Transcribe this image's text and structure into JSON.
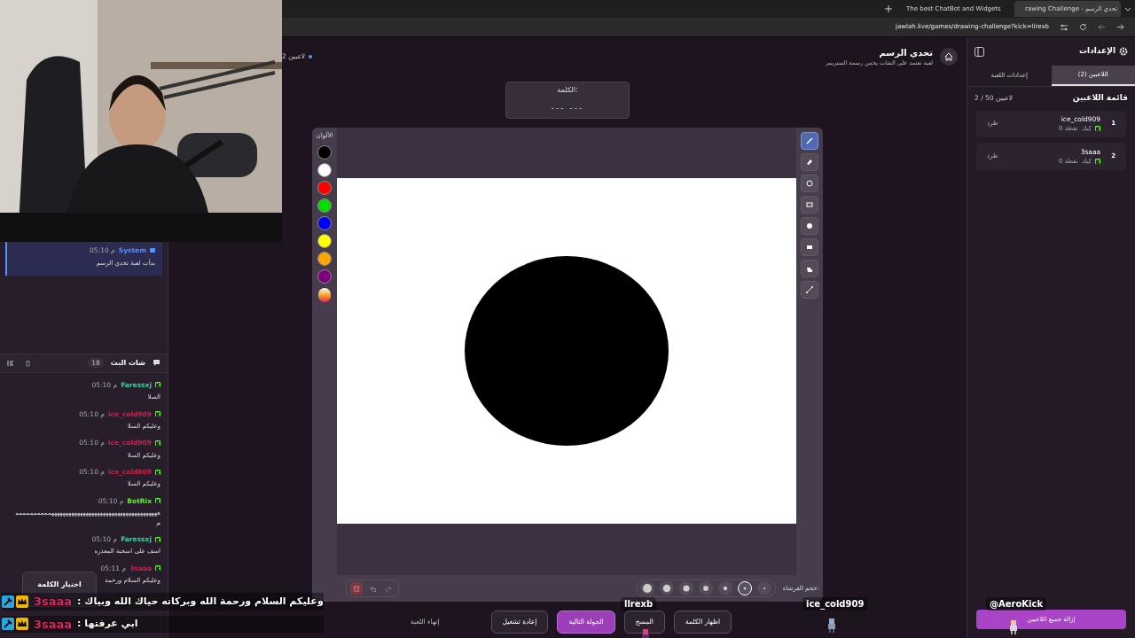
{
  "browser": {
    "tabs": [
      {
        "title": "rawing Challenge - تحدي الرسم",
        "selected": true
      },
      {
        "title": "The best ChatBot and Widgets",
        "selected": false
      }
    ],
    "address": "jawlah.live/games/drawing-challenge?kick=llrexb"
  },
  "header": {
    "title": "تحدي الرسم",
    "subtitle": "لعبة تعتمد على الشات يخمن رسمة الستريمر",
    "player_count": "2 لاعبين"
  },
  "word": {
    "label": "الكلمة:",
    "hint": "--- ---"
  },
  "colors": {
    "label": "الألوان",
    "swatches": [
      {
        "kind": "swatch",
        "color": "#000000"
      },
      {
        "kind": "swatch",
        "color": "#ffffff"
      },
      {
        "kind": "swatch",
        "color": "#ff0000"
      },
      {
        "kind": "swatch",
        "color": "#00dd00"
      },
      {
        "kind": "swatch",
        "color": "#0000ff"
      },
      {
        "kind": "swatch",
        "color": "#ffff00"
      },
      {
        "kind": "swatch",
        "color": "#ffa500"
      },
      {
        "kind": "swatch",
        "color": "#800080"
      },
      {
        "kind": "picker"
      }
    ]
  },
  "tools": [
    {
      "selected": true
    },
    {
      "selected": false
    },
    {
      "selected": false
    },
    {
      "selected": false
    },
    {
      "selected": false
    },
    {
      "selected": false
    },
    {
      "selected": false
    },
    {
      "selected": false
    }
  ],
  "brush": {
    "label": "حجم الفرشاة:",
    "sizes": [
      {
        "selected": false
      },
      {
        "selected": false
      },
      {
        "selected": false
      },
      {
        "selected": false
      },
      {
        "selected": false
      },
      {
        "selected": true
      },
      {
        "selected": false
      }
    ]
  },
  "actions": [
    {
      "label": "اظهار الكلمة",
      "kind": "secondary"
    },
    {
      "label": "المسح",
      "kind": "secondary"
    },
    {
      "label": "الجولة التالية",
      "kind": "primary"
    },
    {
      "label": "إعادة تشغيل",
      "kind": "secondary"
    },
    {
      "label": "إنهاء اللعبة",
      "kind": "link"
    }
  ],
  "chat": {
    "title": "شات البث",
    "count": "18",
    "system": {
      "user": "System",
      "time": "05:10 م",
      "text": "بدأت لعبة تحدي الرسم"
    },
    "messages": [
      {
        "user": "Faressxj",
        "color": "#2fd6a0",
        "time": "05:10 م",
        "text": "السلا"
      },
      {
        "user": "ice_cold909",
        "color": "#d0204a",
        "time": "05:10 م",
        "text": "وعليكم السلا"
      },
      {
        "user": "ice_cold909",
        "color": "#d0204a",
        "time": "05:10 م",
        "text": "وعليكم السلا"
      },
      {
        "user": "ice_cold909",
        "color": "#d0204a",
        "time": "05:10 م",
        "text": "وعليكم السلا"
      },
      {
        "user": "BotRix",
        "color": "#53fc18",
        "time": "05:10 م",
        "text": "ههههههههههههههههههههههههههههههههههههههممممممممممم"
      },
      {
        "user": "Faressxj",
        "color": "#2fd6a0",
        "time": "05:10 م",
        "text": "اسف على اسحبة المعذره"
      },
      {
        "user": "3saaa",
        "color": "#d0204a",
        "time": "05:11 م",
        "text": "وعليكم السلام ورحمة"
      }
    ]
  },
  "word_picker": {
    "title": "اختيار الكلمة"
  },
  "sidebar": {
    "title": "الإعدادات",
    "tabs": [
      {
        "label": "اللاعبين (2)",
        "selected": true
      },
      {
        "label": "إعدادات اللعبة",
        "selected": false
      }
    ],
    "list_title": "قائمة اللاعبين",
    "capacity": "2 / 50 لاعبين",
    "players": [
      {
        "rank": "1",
        "name": "ice_cold909",
        "platform": "كيك",
        "points": "0 نقطة",
        "action": "طرد"
      },
      {
        "rank": "2",
        "name": "3saaa",
        "platform": "كيك",
        "points": "0 نقطة",
        "action": "طرد"
      }
    ],
    "remove_all": "إزالة جميع اللاعبين"
  },
  "overlay": {
    "messages": [
      {
        "user": "3saaa",
        "text": "وعليكم السلام ورحمة الله وبركاته حياك الله وبياك :"
      },
      {
        "user": "3saaa",
        "text": "ابي عرفتها :"
      }
    ],
    "labels": [
      "@AeroKick",
      "ice_cold909",
      "llrexb"
    ]
  }
}
